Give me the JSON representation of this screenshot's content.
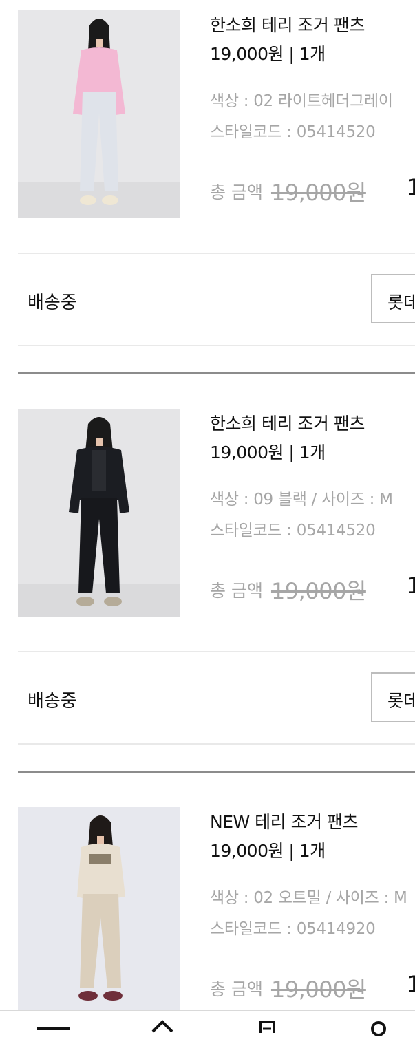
{
  "orders": [
    {
      "product_name": "한소희 테리 조거 팬츠",
      "price_qty": "19,000원 | 1개",
      "color_option": "색상 : 02 라이트헤더그레이",
      "style_code": "스타일코드 : 05414520",
      "total_label": "총 금액",
      "original_price": "19,000원",
      "final_price_partial": "1",
      "status": "배송중",
      "carrier_button": "롯데택배",
      "image": {
        "top_color": "#f3b8d3",
        "pants_color": "#dfe3ea",
        "bg": "#e7e7e9"
      }
    },
    {
      "product_name": "한소희 테리 조거 팬츠",
      "price_qty": "19,000원 | 1개",
      "color_option": "색상 : 09 블랙 / 사이즈 : M",
      "style_code": "스타일코드 : 05414520",
      "total_label": "총 금액",
      "original_price": "19,000원",
      "final_price_partial": "1",
      "status": "배송중",
      "carrier_button": "롯데택배",
      "image": {
        "top_color": "#1b1d22",
        "pants_color": "#17181c",
        "bg": "#e5e5e7"
      }
    },
    {
      "product_name": "NEW 테리 조거 팬츠",
      "price_qty": "19,000원 | 1개",
      "color_option": "색상 : 02 오트밀 / 사이즈 : M",
      "style_code": "스타일코드 : 05414920",
      "total_label": "총 금액",
      "original_price": "19,000원",
      "final_price_partial": "1",
      "image": {
        "top_color": "#e8dfd0",
        "pants_color": "#dbcfbc",
        "bg": "#e7e8ee"
      }
    }
  ],
  "bottom_nav": [
    {
      "icon": "menu-icon"
    },
    {
      "icon": "home-icon"
    },
    {
      "icon": "order-list-icon"
    },
    {
      "icon": "my-page-icon"
    }
  ]
}
